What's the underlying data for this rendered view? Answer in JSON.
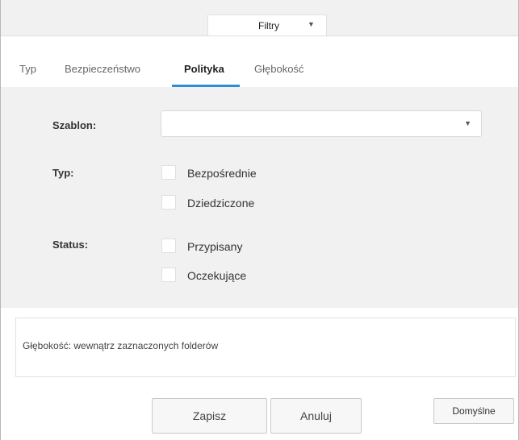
{
  "topbar": {
    "filter_label": "Filtry",
    "filter_caret_icon": "caret-down-icon"
  },
  "tabs": [
    {
      "label": "Typ",
      "active": false
    },
    {
      "label": "Bezpieczeństwo",
      "active": false
    },
    {
      "label": "Polityka",
      "active": true
    },
    {
      "label": "Głębokość",
      "active": false
    }
  ],
  "accent_color": "#2d8fd3",
  "form": {
    "template_label": "Szablon:",
    "template_value": "",
    "type_label": "Typ:",
    "type_options": [
      {
        "label": "Bezpośrednie",
        "checked": false
      },
      {
        "label": "Dziedziczone",
        "checked": false
      }
    ],
    "status_label": "Status:",
    "status_options": [
      {
        "label": "Przypisany",
        "checked": false
      },
      {
        "label": "Oczekujące",
        "checked": false
      }
    ]
  },
  "description": "Głębokość: wewnątrz zaznaczonych folderów",
  "buttons": {
    "save": "Zapisz",
    "cancel": "Anuluj",
    "default": "Domyślne"
  }
}
